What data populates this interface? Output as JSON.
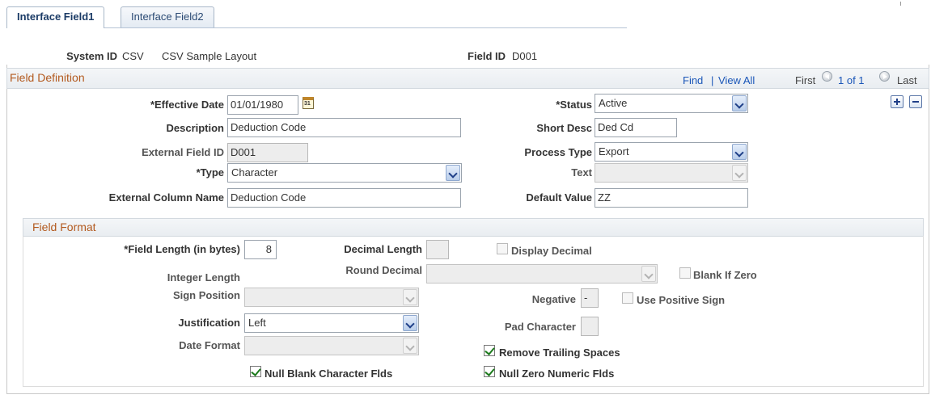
{
  "tabs": [
    {
      "label": "Interface Field1"
    },
    {
      "label": "Interface Field2"
    }
  ],
  "header": {
    "system_id_label": "System ID",
    "system_id_value": "CSV",
    "system_desc": "CSV Sample Layout",
    "field_id_label": "Field ID",
    "field_id_value": "D001"
  },
  "field_definition": {
    "title": "Field Definition",
    "find": "Find",
    "separator": "|",
    "view_all": "View All",
    "first": "First",
    "count": "1 of 1",
    "last": "Last",
    "effective_date_label": "*Effective Date",
    "effective_date_value": "01/01/1980",
    "calendar_glyph": "31",
    "status_label": "*Status",
    "status_value": "Active",
    "description_label": "Description",
    "description_value": "Deduction Code",
    "short_desc_label": "Short Desc",
    "short_desc_value": "Ded Cd",
    "external_field_id_label": "External Field ID",
    "external_field_id_value": "D001",
    "process_type_label": "Process Type",
    "process_type_value": "Export",
    "type_label": "*Type",
    "type_value": "Character",
    "text_label": "Text",
    "text_value": "",
    "external_column_label": "External Column Name",
    "external_column_value": "Deduction Code",
    "default_value_label": "Default Value",
    "default_value_value": "ZZ"
  },
  "field_format": {
    "title": "Field Format",
    "field_length_label": "*Field Length (in bytes)",
    "field_length_value": "8",
    "decimal_length_label": "Decimal Length",
    "decimal_length_value": "",
    "display_decimal_label": "Display Decimal",
    "display_decimal_checked": false,
    "integer_length_label": "Integer Length",
    "round_decimal_label": "Round Decimal",
    "round_decimal_value": "",
    "blank_if_zero_label": "Blank If Zero",
    "blank_if_zero_checked": false,
    "sign_position_label": "Sign Position",
    "sign_position_value": "",
    "negative_label": "Negative",
    "negative_value": "-",
    "use_positive_sign_label": "Use Positive Sign",
    "use_positive_sign_checked": false,
    "justification_label": "Justification",
    "justification_value": "Left",
    "pad_character_label": "Pad Character",
    "pad_character_value": "",
    "date_format_label": "Date Format",
    "date_format_value": "",
    "remove_trailing_label": "Remove Trailing Spaces",
    "remove_trailing_checked": true,
    "null_blank_label": "Null Blank Character Flds",
    "null_blank_checked": true,
    "null_zero_label": "Null Zero Numeric Flds",
    "null_zero_checked": true
  },
  "colors": {
    "section_title": "#b35a1f",
    "link": "#1a56b8",
    "check": "#1c7a1c"
  },
  "icons": [
    "calendar-icon",
    "chevron-down-icon",
    "prev-arrow-icon",
    "next-arrow-icon",
    "plus-icon",
    "minus-icon",
    "checkmark-icon"
  ]
}
